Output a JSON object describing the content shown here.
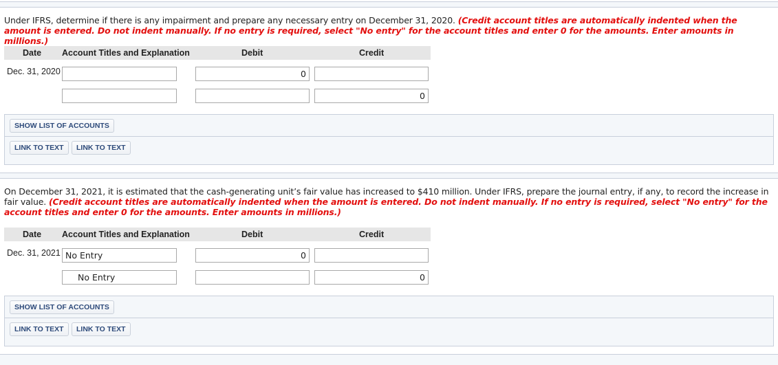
{
  "part1": {
    "question": "Under IFRS, determine if there is any impairment and prepare any necessary entry on December 31, 2020.",
    "note": "(Credit account titles are automatically indented when the amount is entered. Do not indent manually. If no entry is required, select \"No entry\" for the account titles and enter 0 for the amounts. Enter amounts in millions.)",
    "table": {
      "headers": {
        "date": "Date",
        "account": "Account Titles and Explanation",
        "debit": "Debit",
        "credit": "Credit"
      },
      "rows": [
        {
          "date": "Dec. 31, 2020",
          "account": "",
          "debit": "0",
          "credit": ""
        },
        {
          "date": "",
          "account": "",
          "debit": "",
          "credit": "0"
        }
      ]
    },
    "buttons": {
      "show_accounts": "SHOW LIST OF ACCOUNTS",
      "link1": "LINK TO TEXT",
      "link2": "LINK TO TEXT"
    }
  },
  "part2": {
    "question": "On December 31, 2021, it is estimated that the cash-generating unit’s fair value has increased to $410 million. Under IFRS, prepare the journal entry, if any, to record the increase in fair value.",
    "note": "(Credit account titles are automatically indented when the amount is entered. Do not indent manually. If no entry is required, select \"No entry\" for the account titles and enter 0 for the amounts. Enter amounts in millions.)",
    "table": {
      "headers": {
        "date": "Date",
        "account": "Account Titles and Explanation",
        "debit": "Debit",
        "credit": "Credit"
      },
      "rows": [
        {
          "date": "Dec. 31, 2021",
          "account": "No Entry",
          "debit": "0",
          "credit": ""
        },
        {
          "date": "",
          "account": "No Entry",
          "debit": "",
          "credit": "0"
        }
      ]
    },
    "buttons": {
      "show_accounts": "SHOW LIST OF ACCOUNTS",
      "link1": "LINK TO TEXT",
      "link2": "LINK TO TEXT"
    }
  }
}
